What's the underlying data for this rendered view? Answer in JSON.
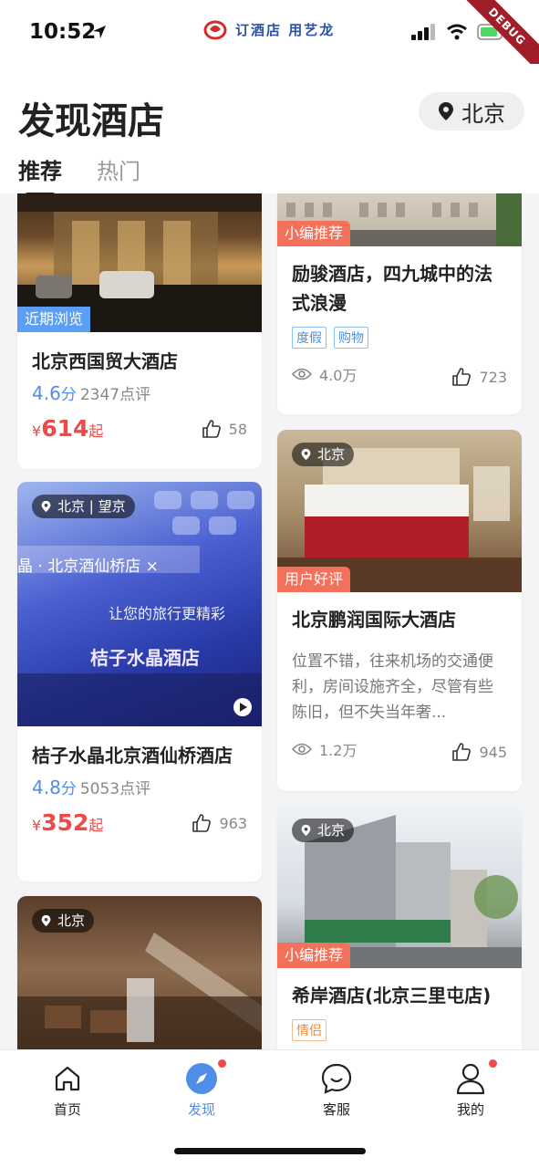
{
  "status_bar": {
    "time": "10:52",
    "brand": "订酒店 用艺龙",
    "debug_ribbon": "DEBUG"
  },
  "header": {
    "title": "发现酒店",
    "city": "北京",
    "tabs": [
      "推荐",
      "热门"
    ]
  },
  "cards": {
    "c1": {
      "tag": "近期浏览",
      "title": "北京西国贸大酒店",
      "score": "4.6",
      "score_unit": "分",
      "reviews": "2347点评",
      "price_symbol": "¥",
      "price": "614",
      "price_suffix": "起",
      "likes": "58"
    },
    "c2": {
      "location": "北京 | 望京",
      "title": "桔子水晶北京酒仙桥酒店",
      "score": "4.8",
      "score_unit": "分",
      "reviews": "5053点评",
      "price_symbol": "¥",
      "price": "352",
      "price_suffix": "起",
      "likes": "963",
      "img_text_1": "晶 · 北京酒仙桥店 ×",
      "img_text_2": "让您的旅行更精彩",
      "img_text_3": "桔子水晶酒店"
    },
    "c3": {
      "location": "北京"
    },
    "c4": {
      "tag": "小编推荐",
      "title": "励骏酒店，四九城中的法式浪漫",
      "tags": [
        "度假",
        "购物"
      ],
      "views": "4.0万",
      "likes": "723"
    },
    "c5": {
      "location": "北京",
      "tag": "用户好评",
      "title": "北京鹏润国际大酒店",
      "desc": "位置不错，往来机场的交通便利，房间设施齐全，尽管有些陈旧，但不失当年奢...",
      "views": "1.2万",
      "likes": "945"
    },
    "c6": {
      "location": "北京",
      "tag": "小编推荐",
      "title": "希岸酒店(北京三里屯店)",
      "tags": [
        "情侣"
      ]
    }
  },
  "bottom_nav": [
    {
      "label": "首页",
      "icon": "home-icon"
    },
    {
      "label": "发现",
      "icon": "compass-icon"
    },
    {
      "label": "客服",
      "icon": "chat-icon"
    },
    {
      "label": "我的",
      "icon": "user-icon"
    }
  ],
  "colors": {
    "accent": "#4f8de8",
    "price": "#ef4a4a",
    "tag_blue": "#5b9ef5",
    "tag_orange": "#f3705a"
  }
}
